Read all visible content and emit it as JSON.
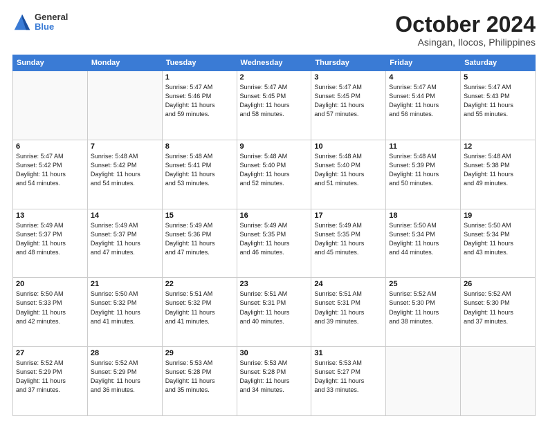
{
  "header": {
    "logo": {
      "general": "General",
      "blue": "Blue"
    },
    "month": "October 2024",
    "location": "Asingan, Ilocos, Philippines"
  },
  "weekdays": [
    "Sunday",
    "Monday",
    "Tuesday",
    "Wednesday",
    "Thursday",
    "Friday",
    "Saturday"
  ],
  "weeks": [
    [
      {
        "day": "",
        "detail": ""
      },
      {
        "day": "",
        "detail": ""
      },
      {
        "day": "1",
        "detail": "Sunrise: 5:47 AM\nSunset: 5:46 PM\nDaylight: 11 hours\nand 59 minutes."
      },
      {
        "day": "2",
        "detail": "Sunrise: 5:47 AM\nSunset: 5:45 PM\nDaylight: 11 hours\nand 58 minutes."
      },
      {
        "day": "3",
        "detail": "Sunrise: 5:47 AM\nSunset: 5:45 PM\nDaylight: 11 hours\nand 57 minutes."
      },
      {
        "day": "4",
        "detail": "Sunrise: 5:47 AM\nSunset: 5:44 PM\nDaylight: 11 hours\nand 56 minutes."
      },
      {
        "day": "5",
        "detail": "Sunrise: 5:47 AM\nSunset: 5:43 PM\nDaylight: 11 hours\nand 55 minutes."
      }
    ],
    [
      {
        "day": "6",
        "detail": "Sunrise: 5:47 AM\nSunset: 5:42 PM\nDaylight: 11 hours\nand 54 minutes."
      },
      {
        "day": "7",
        "detail": "Sunrise: 5:48 AM\nSunset: 5:42 PM\nDaylight: 11 hours\nand 54 minutes."
      },
      {
        "day": "8",
        "detail": "Sunrise: 5:48 AM\nSunset: 5:41 PM\nDaylight: 11 hours\nand 53 minutes."
      },
      {
        "day": "9",
        "detail": "Sunrise: 5:48 AM\nSunset: 5:40 PM\nDaylight: 11 hours\nand 52 minutes."
      },
      {
        "day": "10",
        "detail": "Sunrise: 5:48 AM\nSunset: 5:40 PM\nDaylight: 11 hours\nand 51 minutes."
      },
      {
        "day": "11",
        "detail": "Sunrise: 5:48 AM\nSunset: 5:39 PM\nDaylight: 11 hours\nand 50 minutes."
      },
      {
        "day": "12",
        "detail": "Sunrise: 5:48 AM\nSunset: 5:38 PM\nDaylight: 11 hours\nand 49 minutes."
      }
    ],
    [
      {
        "day": "13",
        "detail": "Sunrise: 5:49 AM\nSunset: 5:37 PM\nDaylight: 11 hours\nand 48 minutes."
      },
      {
        "day": "14",
        "detail": "Sunrise: 5:49 AM\nSunset: 5:37 PM\nDaylight: 11 hours\nand 47 minutes."
      },
      {
        "day": "15",
        "detail": "Sunrise: 5:49 AM\nSunset: 5:36 PM\nDaylight: 11 hours\nand 47 minutes."
      },
      {
        "day": "16",
        "detail": "Sunrise: 5:49 AM\nSunset: 5:35 PM\nDaylight: 11 hours\nand 46 minutes."
      },
      {
        "day": "17",
        "detail": "Sunrise: 5:49 AM\nSunset: 5:35 PM\nDaylight: 11 hours\nand 45 minutes."
      },
      {
        "day": "18",
        "detail": "Sunrise: 5:50 AM\nSunset: 5:34 PM\nDaylight: 11 hours\nand 44 minutes."
      },
      {
        "day": "19",
        "detail": "Sunrise: 5:50 AM\nSunset: 5:34 PM\nDaylight: 11 hours\nand 43 minutes."
      }
    ],
    [
      {
        "day": "20",
        "detail": "Sunrise: 5:50 AM\nSunset: 5:33 PM\nDaylight: 11 hours\nand 42 minutes."
      },
      {
        "day": "21",
        "detail": "Sunrise: 5:50 AM\nSunset: 5:32 PM\nDaylight: 11 hours\nand 41 minutes."
      },
      {
        "day": "22",
        "detail": "Sunrise: 5:51 AM\nSunset: 5:32 PM\nDaylight: 11 hours\nand 41 minutes."
      },
      {
        "day": "23",
        "detail": "Sunrise: 5:51 AM\nSunset: 5:31 PM\nDaylight: 11 hours\nand 40 minutes."
      },
      {
        "day": "24",
        "detail": "Sunrise: 5:51 AM\nSunset: 5:31 PM\nDaylight: 11 hours\nand 39 minutes."
      },
      {
        "day": "25",
        "detail": "Sunrise: 5:52 AM\nSunset: 5:30 PM\nDaylight: 11 hours\nand 38 minutes."
      },
      {
        "day": "26",
        "detail": "Sunrise: 5:52 AM\nSunset: 5:30 PM\nDaylight: 11 hours\nand 37 minutes."
      }
    ],
    [
      {
        "day": "27",
        "detail": "Sunrise: 5:52 AM\nSunset: 5:29 PM\nDaylight: 11 hours\nand 37 minutes."
      },
      {
        "day": "28",
        "detail": "Sunrise: 5:52 AM\nSunset: 5:29 PM\nDaylight: 11 hours\nand 36 minutes."
      },
      {
        "day": "29",
        "detail": "Sunrise: 5:53 AM\nSunset: 5:28 PM\nDaylight: 11 hours\nand 35 minutes."
      },
      {
        "day": "30",
        "detail": "Sunrise: 5:53 AM\nSunset: 5:28 PM\nDaylight: 11 hours\nand 34 minutes."
      },
      {
        "day": "31",
        "detail": "Sunrise: 5:53 AM\nSunset: 5:27 PM\nDaylight: 11 hours\nand 33 minutes."
      },
      {
        "day": "",
        "detail": ""
      },
      {
        "day": "",
        "detail": ""
      }
    ]
  ]
}
